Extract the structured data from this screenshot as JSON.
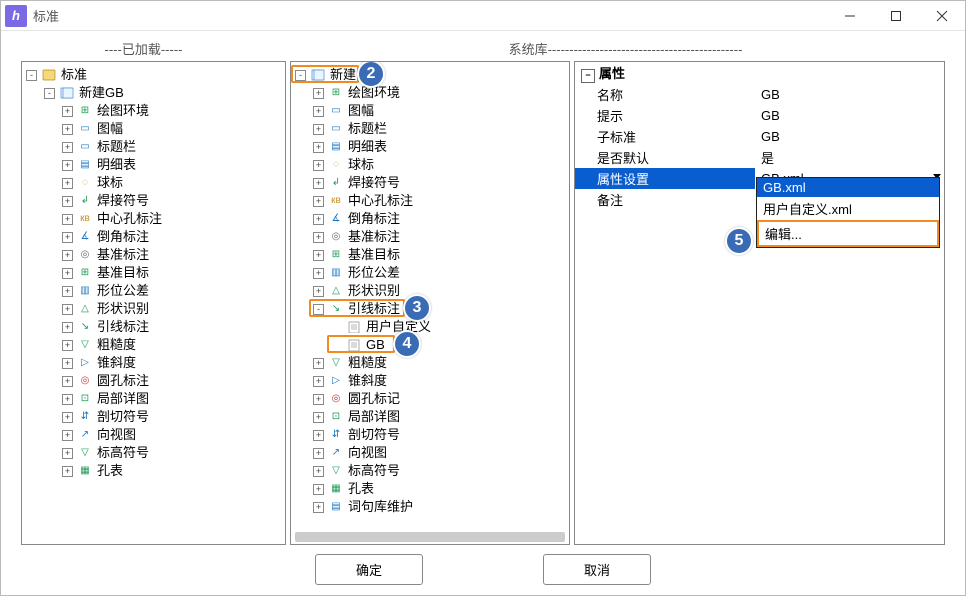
{
  "window": {
    "title": "标准"
  },
  "headers": {
    "left": "----已加载-----",
    "mid": "系统库---------------------------------------------"
  },
  "left_tree": [
    {
      "d": 0,
      "exp": "-",
      "icon": "book",
      "label": "标准"
    },
    {
      "d": 1,
      "exp": "-",
      "icon": "std",
      "label": "新建GB"
    },
    {
      "d": 2,
      "exp": "+",
      "icon": "env",
      "col": "#1e9e54",
      "label": "绘图环境"
    },
    {
      "d": 2,
      "exp": "+",
      "icon": "gen",
      "col": "#1b77c4",
      "glyph": "▭",
      "label": "图幅"
    },
    {
      "d": 2,
      "exp": "+",
      "icon": "gen",
      "col": "#1b77c4",
      "glyph": "▭",
      "label": "标题栏"
    },
    {
      "d": 2,
      "exp": "+",
      "icon": "gen",
      "col": "#1b77c4",
      "glyph": "▤",
      "label": "明细表"
    },
    {
      "d": 2,
      "exp": "+",
      "icon": "gen",
      "col": "#c7902a",
      "glyph": "◌",
      "label": "球标"
    },
    {
      "d": 2,
      "exp": "+",
      "icon": "gen",
      "col": "#1e9954",
      "glyph": "↲",
      "label": "焊接符号"
    },
    {
      "d": 2,
      "exp": "+",
      "icon": "gen",
      "col": "#c7902a",
      "glyph": "кв",
      "label": "中心孔标注"
    },
    {
      "d": 2,
      "exp": "+",
      "icon": "gen",
      "col": "#1b77c4",
      "glyph": "∡",
      "label": "倒角标注"
    },
    {
      "d": 2,
      "exp": "+",
      "icon": "gen",
      "col": "#6a6a6a",
      "glyph": "◎",
      "label": "基准标注"
    },
    {
      "d": 2,
      "exp": "+",
      "icon": "gen",
      "col": "#1e9954",
      "glyph": "⊞",
      "label": "基准目标"
    },
    {
      "d": 2,
      "exp": "+",
      "icon": "gen",
      "col": "#1b77c4",
      "glyph": "▥",
      "label": "形位公差"
    },
    {
      "d": 2,
      "exp": "+",
      "icon": "gen",
      "col": "#1e9954",
      "glyph": "△",
      "label": "形状识别"
    },
    {
      "d": 2,
      "exp": "+",
      "icon": "gen",
      "col": "#1e9954",
      "glyph": "↘",
      "label": "引线标注"
    },
    {
      "d": 2,
      "exp": "+",
      "icon": "gen",
      "col": "#1e9954",
      "glyph": "▽",
      "label": "粗糙度"
    },
    {
      "d": 2,
      "exp": "+",
      "icon": "gen",
      "col": "#1b77c4",
      "glyph": "▷",
      "label": "锥斜度"
    },
    {
      "d": 2,
      "exp": "+",
      "icon": "gen",
      "col": "#c73a3a",
      "glyph": "◎",
      "label": "圆孔标注"
    },
    {
      "d": 2,
      "exp": "+",
      "icon": "gen",
      "col": "#1e9954",
      "glyph": "⊡",
      "label": "局部详图"
    },
    {
      "d": 2,
      "exp": "+",
      "icon": "gen",
      "col": "#1b77c4",
      "glyph": "⇵",
      "label": "剖切符号"
    },
    {
      "d": 2,
      "exp": "+",
      "icon": "gen",
      "col": "#1b77c4",
      "glyph": "↗",
      "label": "向视图"
    },
    {
      "d": 2,
      "exp": "+",
      "icon": "gen",
      "col": "#1e9954",
      "glyph": "▽",
      "label": "标高符号"
    },
    {
      "d": 2,
      "exp": "+",
      "icon": "gen",
      "col": "#1e9954",
      "glyph": "▦",
      "label": "孔表"
    }
  ],
  "mid_tree": [
    {
      "d": 0,
      "exp": "-",
      "icon": "std",
      "label": "新建",
      "hl": 2
    },
    {
      "d": 1,
      "exp": "+",
      "icon": "env",
      "col": "#1e9e54",
      "label": "绘图环境"
    },
    {
      "d": 1,
      "exp": "+",
      "icon": "gen",
      "col": "#1b77c4",
      "glyph": "▭",
      "label": "图幅"
    },
    {
      "d": 1,
      "exp": "+",
      "icon": "gen",
      "col": "#1b77c4",
      "glyph": "▭",
      "label": "标题栏"
    },
    {
      "d": 1,
      "exp": "+",
      "icon": "gen",
      "col": "#1b77c4",
      "glyph": "▤",
      "label": "明细表"
    },
    {
      "d": 1,
      "exp": "+",
      "icon": "gen",
      "col": "#c7902a",
      "glyph": "◌",
      "label": "球标"
    },
    {
      "d": 1,
      "exp": "+",
      "icon": "gen",
      "col": "#1e9954",
      "glyph": "↲",
      "label": "焊接符号"
    },
    {
      "d": 1,
      "exp": "+",
      "icon": "gen",
      "col": "#c7902a",
      "glyph": "кв",
      "label": "中心孔标注"
    },
    {
      "d": 1,
      "exp": "+",
      "icon": "gen",
      "col": "#1b77c4",
      "glyph": "∡",
      "label": "倒角标注"
    },
    {
      "d": 1,
      "exp": "+",
      "icon": "gen",
      "col": "#6a6a6a",
      "glyph": "◎",
      "label": "基准标注"
    },
    {
      "d": 1,
      "exp": "+",
      "icon": "gen",
      "col": "#1e9954",
      "glyph": "⊞",
      "label": "基准目标"
    },
    {
      "d": 1,
      "exp": "+",
      "icon": "gen",
      "col": "#1b77c4",
      "glyph": "▥",
      "label": "形位公差"
    },
    {
      "d": 1,
      "exp": "+",
      "icon": "gen",
      "col": "#1e9954",
      "glyph": "△",
      "label": "形状识别"
    },
    {
      "d": 1,
      "exp": "-",
      "icon": "gen",
      "col": "#1e9954",
      "glyph": "↘",
      "label": "引线标注",
      "hl": 3
    },
    {
      "d": 2,
      "exp": "",
      "icon": "doc",
      "label": "用户自定义"
    },
    {
      "d": 2,
      "exp": "",
      "icon": "doc",
      "label": "GB",
      "hl": 4
    },
    {
      "d": 1,
      "exp": "+",
      "icon": "gen",
      "col": "#1e9954",
      "glyph": "▽",
      "label": "粗糙度"
    },
    {
      "d": 1,
      "exp": "+",
      "icon": "gen",
      "col": "#1b77c4",
      "glyph": "▷",
      "label": "锥斜度"
    },
    {
      "d": 1,
      "exp": "+",
      "icon": "gen",
      "col": "#c73a3a",
      "glyph": "◎",
      "label": "圆孔标记"
    },
    {
      "d": 1,
      "exp": "+",
      "icon": "gen",
      "col": "#1e9954",
      "glyph": "⊡",
      "label": "局部详图"
    },
    {
      "d": 1,
      "exp": "+",
      "icon": "gen",
      "col": "#1b77c4",
      "glyph": "⇵",
      "label": "剖切符号"
    },
    {
      "d": 1,
      "exp": "+",
      "icon": "gen",
      "col": "#1b77c4",
      "glyph": "↗",
      "label": "向视图"
    },
    {
      "d": 1,
      "exp": "+",
      "icon": "gen",
      "col": "#1e9954",
      "glyph": "▽",
      "label": "标高符号"
    },
    {
      "d": 1,
      "exp": "+",
      "icon": "gen",
      "col": "#1e9954",
      "glyph": "▦",
      "label": "孔表"
    },
    {
      "d": 1,
      "exp": "+",
      "icon": "gen",
      "col": "#1b77c4",
      "glyph": "▤",
      "label": "词句库维护"
    }
  ],
  "props": {
    "header": "属性",
    "rows": [
      {
        "k": "名称",
        "v": "GB"
      },
      {
        "k": "提示",
        "v": "GB"
      },
      {
        "k": "子标准",
        "v": "GB"
      },
      {
        "k": "是否默认",
        "v": "是"
      },
      {
        "k": "属性设置",
        "v": "GB.xml",
        "sel": true,
        "dd": true
      },
      {
        "k": "备注",
        "v": ""
      }
    ],
    "dropdown": [
      "GB.xml",
      "用户自定义.xml",
      "编辑..."
    ],
    "dropdown_sel": 0,
    "dropdown_boxed": 2,
    "badge5": "5"
  },
  "badges": {
    "b2": "2",
    "b3": "3",
    "b4": "4",
    "b5": "5"
  },
  "buttons": {
    "ok": "确定",
    "cancel": "取消"
  }
}
